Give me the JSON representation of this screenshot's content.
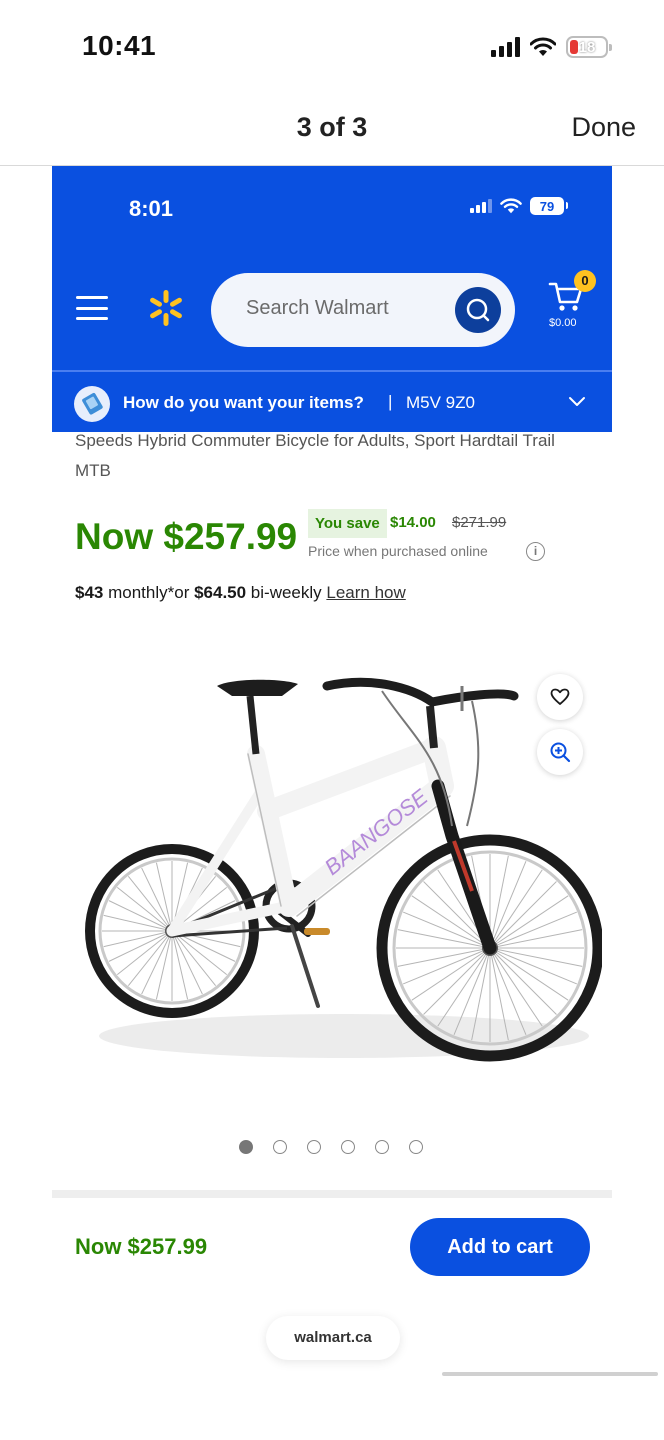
{
  "ios_status": {
    "time": "10:41",
    "battery_level": "18",
    "battery_color": "#e53935"
  },
  "viewer": {
    "title": "3 of 3",
    "done_label": "Done"
  },
  "inner_status": {
    "time": "8:01",
    "battery_level": "79"
  },
  "header": {
    "search_placeholder": "Search Walmart",
    "cart_count": "0",
    "cart_total": "$0.00",
    "brand_color": "#0a50e0",
    "spark_color": "#ffc220"
  },
  "delivery": {
    "question": "How do you want your items?",
    "separator": "|",
    "postal_code": "M5V 9Z0"
  },
  "product": {
    "title": "Speeds Hybrid Commuter Bicycle for Adults, Sport Hardtail Trail MTB",
    "now_price": "Now $257.99",
    "you_save_label": "You save",
    "save_amount": "$14.00",
    "was_price": "$271.99",
    "price_note": "Price when purchased online",
    "monthly_amount": "$43",
    "monthly_text": " monthly*or ",
    "biweekly_amount": "$64.50",
    "biweekly_text": " bi-weekly ",
    "learn_how": "Learn how",
    "frame_text": "BAANGOSE",
    "price_color": "#2a8703"
  },
  "gallery": {
    "total_images": 6,
    "active_index": 0
  },
  "footer": {
    "price": "Now $257.99",
    "add_to_cart": "Add to cart"
  },
  "url_pill": {
    "domain": "walmart.ca"
  },
  "icons": [
    "menu-icon",
    "walmart-spark-icon",
    "search-icon",
    "cart-icon",
    "delivery-icon",
    "chevron-down-icon",
    "info-icon",
    "heart-icon",
    "zoom-icon"
  ]
}
